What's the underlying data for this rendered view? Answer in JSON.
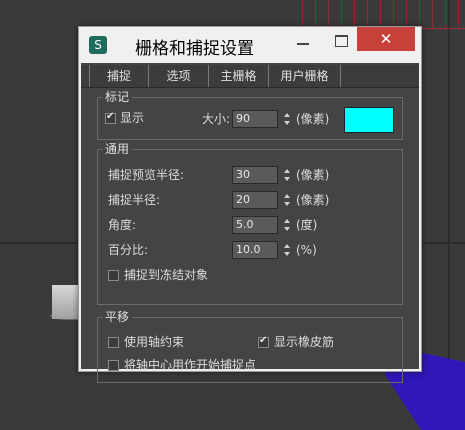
{
  "dialog": {
    "title": "栅格和捕捉设置",
    "icon": "app-3ds-icon",
    "close_glyph": "✕"
  },
  "tabs": [
    {
      "label": "捕捉"
    },
    {
      "label": "选项"
    },
    {
      "label": "主栅格"
    },
    {
      "label": "用户栅格"
    }
  ],
  "markers": {
    "title": "标记",
    "show_label": "显示",
    "show_checked": true,
    "size_label": "大小:",
    "size_value": "90",
    "size_unit": "(像素)",
    "color": "#00ffff"
  },
  "general": {
    "title": "通用",
    "snap_preview_radius_label": "捕捉预览半径:",
    "snap_preview_radius_value": "30",
    "snap_preview_radius_unit": "(像素)",
    "snap_radius_label": "捕捉半径:",
    "snap_radius_value": "20",
    "snap_radius_unit": "(像素)",
    "angle_label": "角度:",
    "angle_value": "5.0",
    "angle_unit": "(度)",
    "percent_label": "百分比:",
    "percent_value": "10.0",
    "percent_unit": "(%)",
    "snap_frozen_label": "捕捉到冻结对象",
    "snap_frozen_checked": false
  },
  "translation": {
    "title": "平移",
    "axis_constraints_label": "使用轴约束",
    "axis_constraints_checked": false,
    "rubber_band_label": "显示橡皮筋",
    "rubber_band_checked": true,
    "pivot_start_label": "将轴中心用作开始捕捉点",
    "pivot_start_checked": false
  }
}
